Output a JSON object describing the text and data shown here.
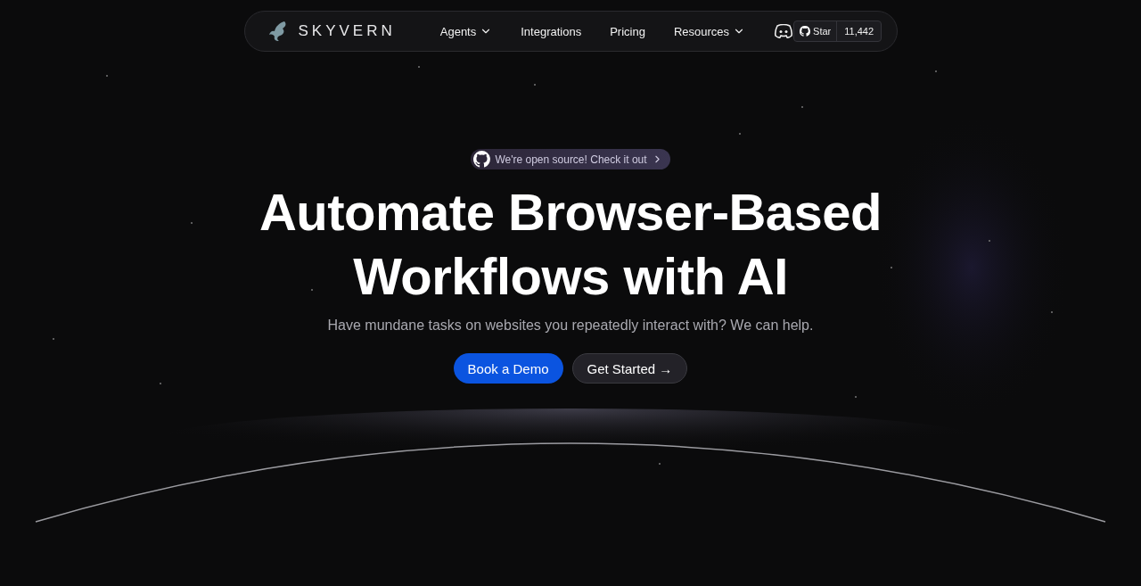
{
  "nav": {
    "brand": "SKYVERN",
    "items": [
      {
        "label": "Agents",
        "has_menu": true
      },
      {
        "label": "Integrations",
        "has_menu": false
      },
      {
        "label": "Pricing",
        "has_menu": false
      },
      {
        "label": "Resources",
        "has_menu": true
      }
    ],
    "github": {
      "label": "Star",
      "count": "11,442"
    }
  },
  "hero": {
    "badge": "We're open source! Check it out",
    "headline": [
      "Automate Browser-Based",
      "Workflows with AI"
    ],
    "subtitle": "Have mundane tasks on websites you repeatedly interact with? We can help.",
    "buttons": [
      {
        "label": "Book a Demo",
        "kind": "primary"
      },
      {
        "label": "Get Started →",
        "kind": "secondary"
      }
    ]
  }
}
